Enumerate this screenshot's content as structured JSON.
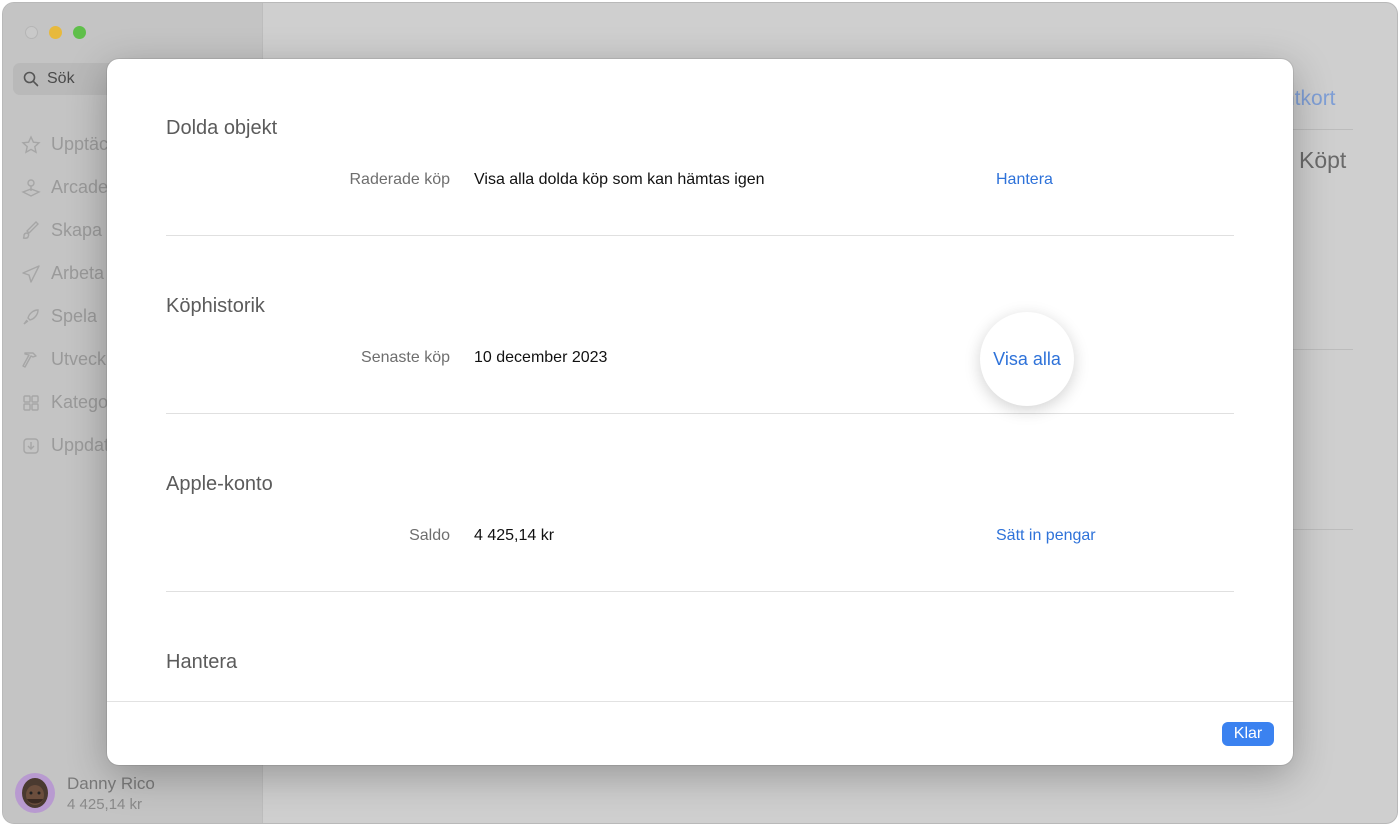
{
  "sidebar": {
    "search_placeholder": "Sök",
    "items": [
      {
        "label": "Upptäck",
        "icon": "star-icon"
      },
      {
        "label": "Arcade",
        "icon": "joystick-icon"
      },
      {
        "label": "Skapa",
        "icon": "brush-icon"
      },
      {
        "label": "Arbeta",
        "icon": "paperplane-icon"
      },
      {
        "label": "Spela",
        "icon": "rocket-icon"
      },
      {
        "label": "Utveckla",
        "icon": "hammer-icon"
      },
      {
        "label": "Kategorier",
        "icon": "grid-icon"
      },
      {
        "label": "Uppdateringar",
        "icon": "download-icon"
      }
    ],
    "account": {
      "name": "Danny Rico",
      "balance": "4 425,14 kr"
    }
  },
  "background": {
    "link_partial": "ntkort",
    "title_partial": "Köpt"
  },
  "modal": {
    "sections": [
      {
        "title": "Dolda objekt",
        "label": "Raderade köp",
        "value": "Visa alla dolda köp som kan hämtas igen",
        "action": "Hantera"
      },
      {
        "title": "Köphistorik",
        "label": "Senaste köp",
        "value": "10 december 2023",
        "action": "Visa alla"
      },
      {
        "title": "Apple-konto",
        "label": "Saldo",
        "value": "4 425,14 kr",
        "action": "Sätt in pengar"
      },
      {
        "title": "Hantera"
      }
    ],
    "done_label": "Klar"
  },
  "colors": {
    "accent": "#2e72d9",
    "button": "#3b82f0"
  }
}
